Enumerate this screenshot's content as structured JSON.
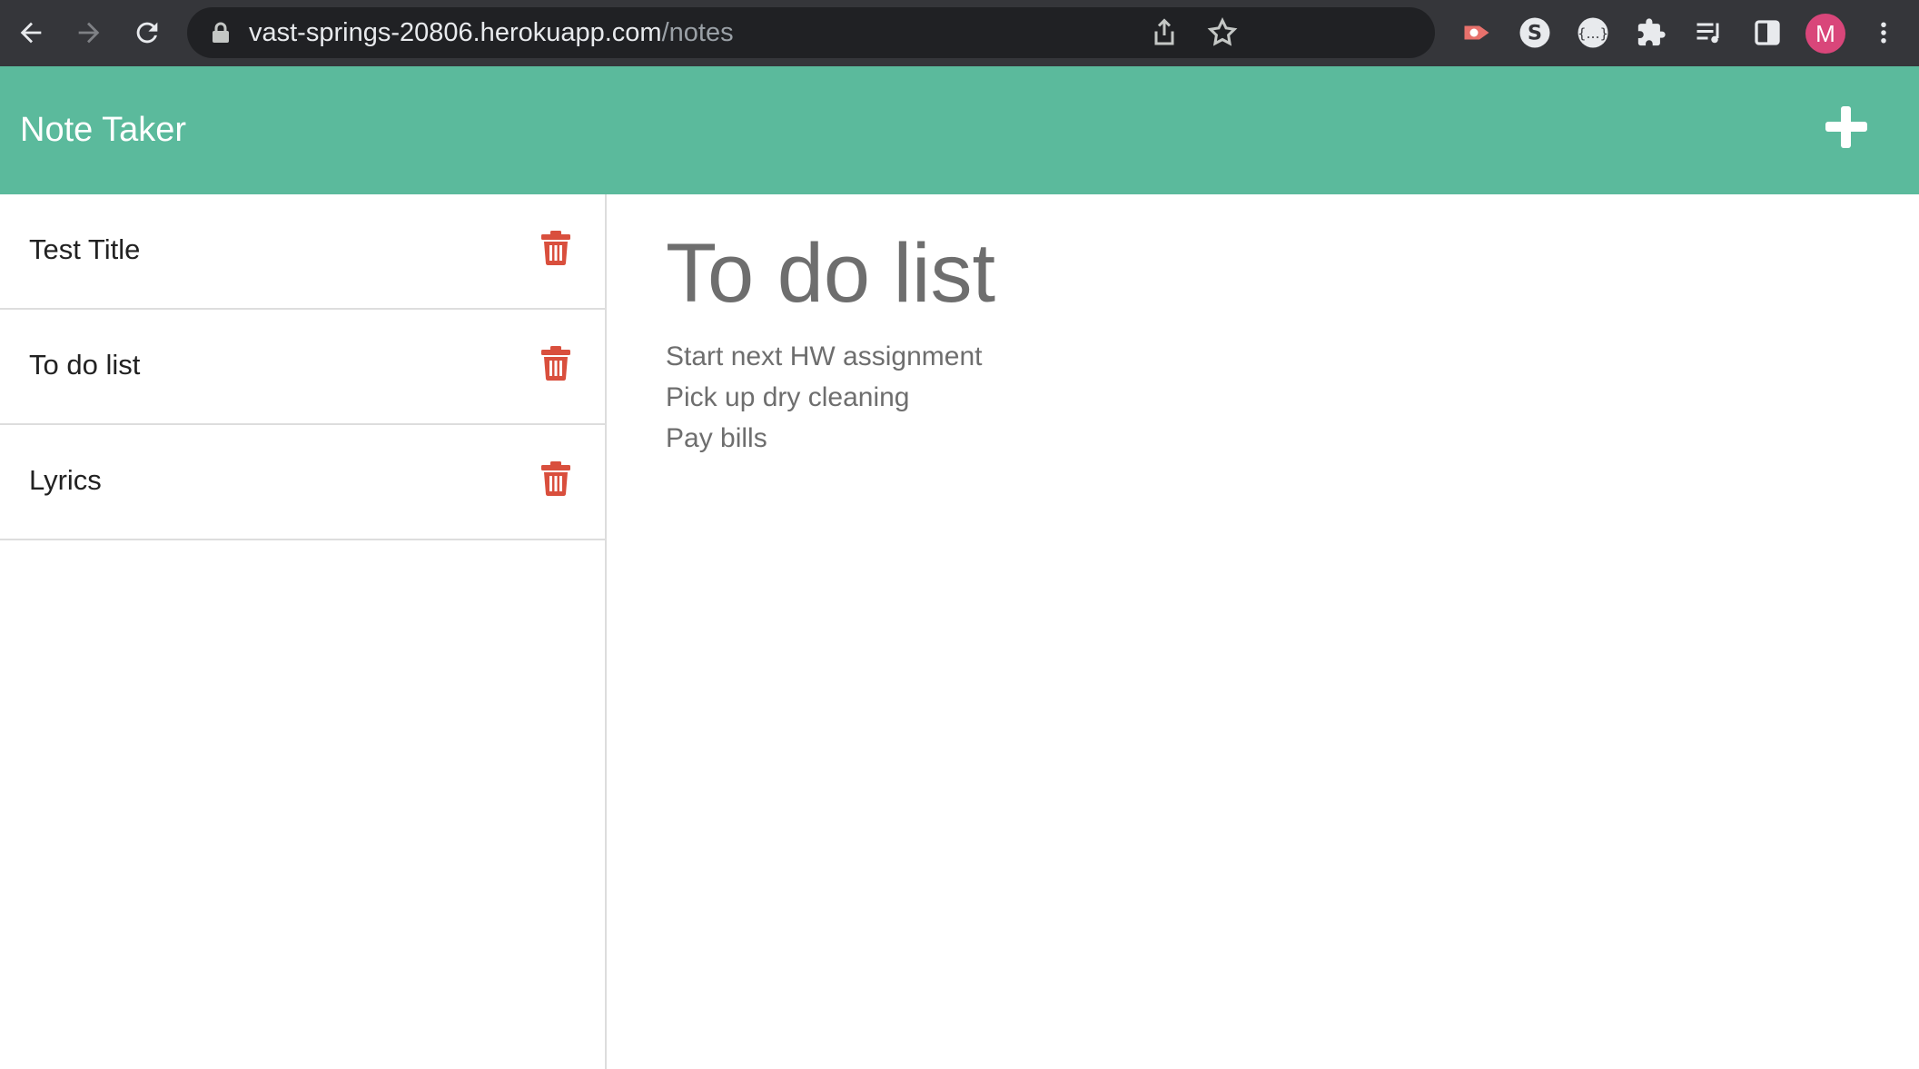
{
  "browser": {
    "url_host": "vast-springs-20806.herokuapp.com",
    "url_path": "/notes",
    "avatar_letter": "M"
  },
  "app": {
    "title": "Note Taker",
    "accent": "#5bba9c",
    "trash_color": "#d94f3d"
  },
  "notes": [
    {
      "title": "Test Title"
    },
    {
      "title": "To do list"
    },
    {
      "title": "Lyrics"
    }
  ],
  "active_note": {
    "title": "To do list",
    "lines": [
      "Start next HW assignment",
      "Pick up dry cleaning",
      "Pay bills"
    ]
  }
}
